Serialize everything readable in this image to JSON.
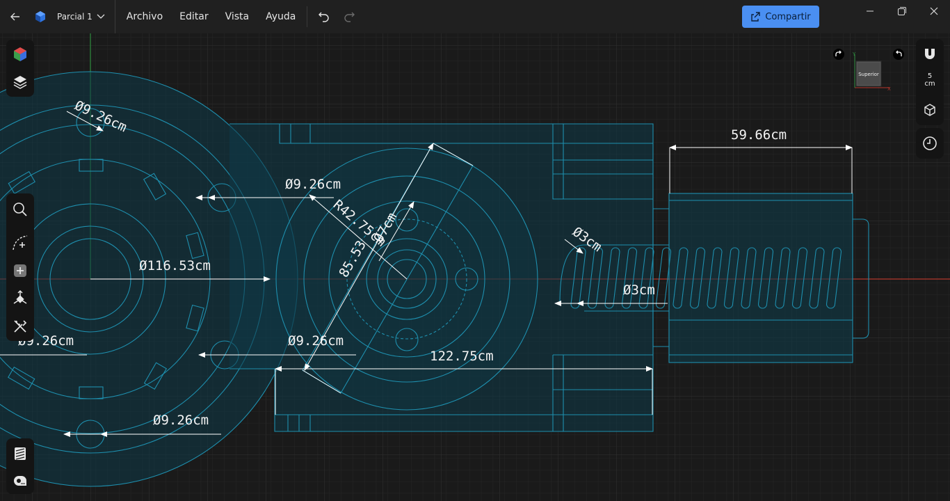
{
  "titlebar": {
    "document_name": "Parcial 1",
    "menu": [
      "Archivo",
      "Editar",
      "Vista",
      "Ayuda"
    ],
    "share_label": "Compartir"
  },
  "view": {
    "cube_face": "Superior",
    "axis_x": "X",
    "axis_y": "Y",
    "grid_value": "5",
    "grid_unit": "cm"
  },
  "dimensions": {
    "d1": "Ø9.26cm",
    "d2": "Ø9.26cm",
    "d3": "R42.75cm",
    "d4": "Ø7cm",
    "d5": "85.53",
    "d6": "Ø116.53cm",
    "d7": "Ø9.26cm",
    "d8": "Ø9.26cm",
    "d9": "122.75cm",
    "d10": "Ø9.26cm",
    "d11": "59.66cm",
    "d12": "Ø3cm",
    "d13": "Ø3cm"
  },
  "colors": {
    "accent": "#4a8ff2",
    "sketch_line": "#1e8fae",
    "sketch_fill": "#0f3a48",
    "axis_red": "#c0392b",
    "axis_green": "#2e8b3e"
  }
}
